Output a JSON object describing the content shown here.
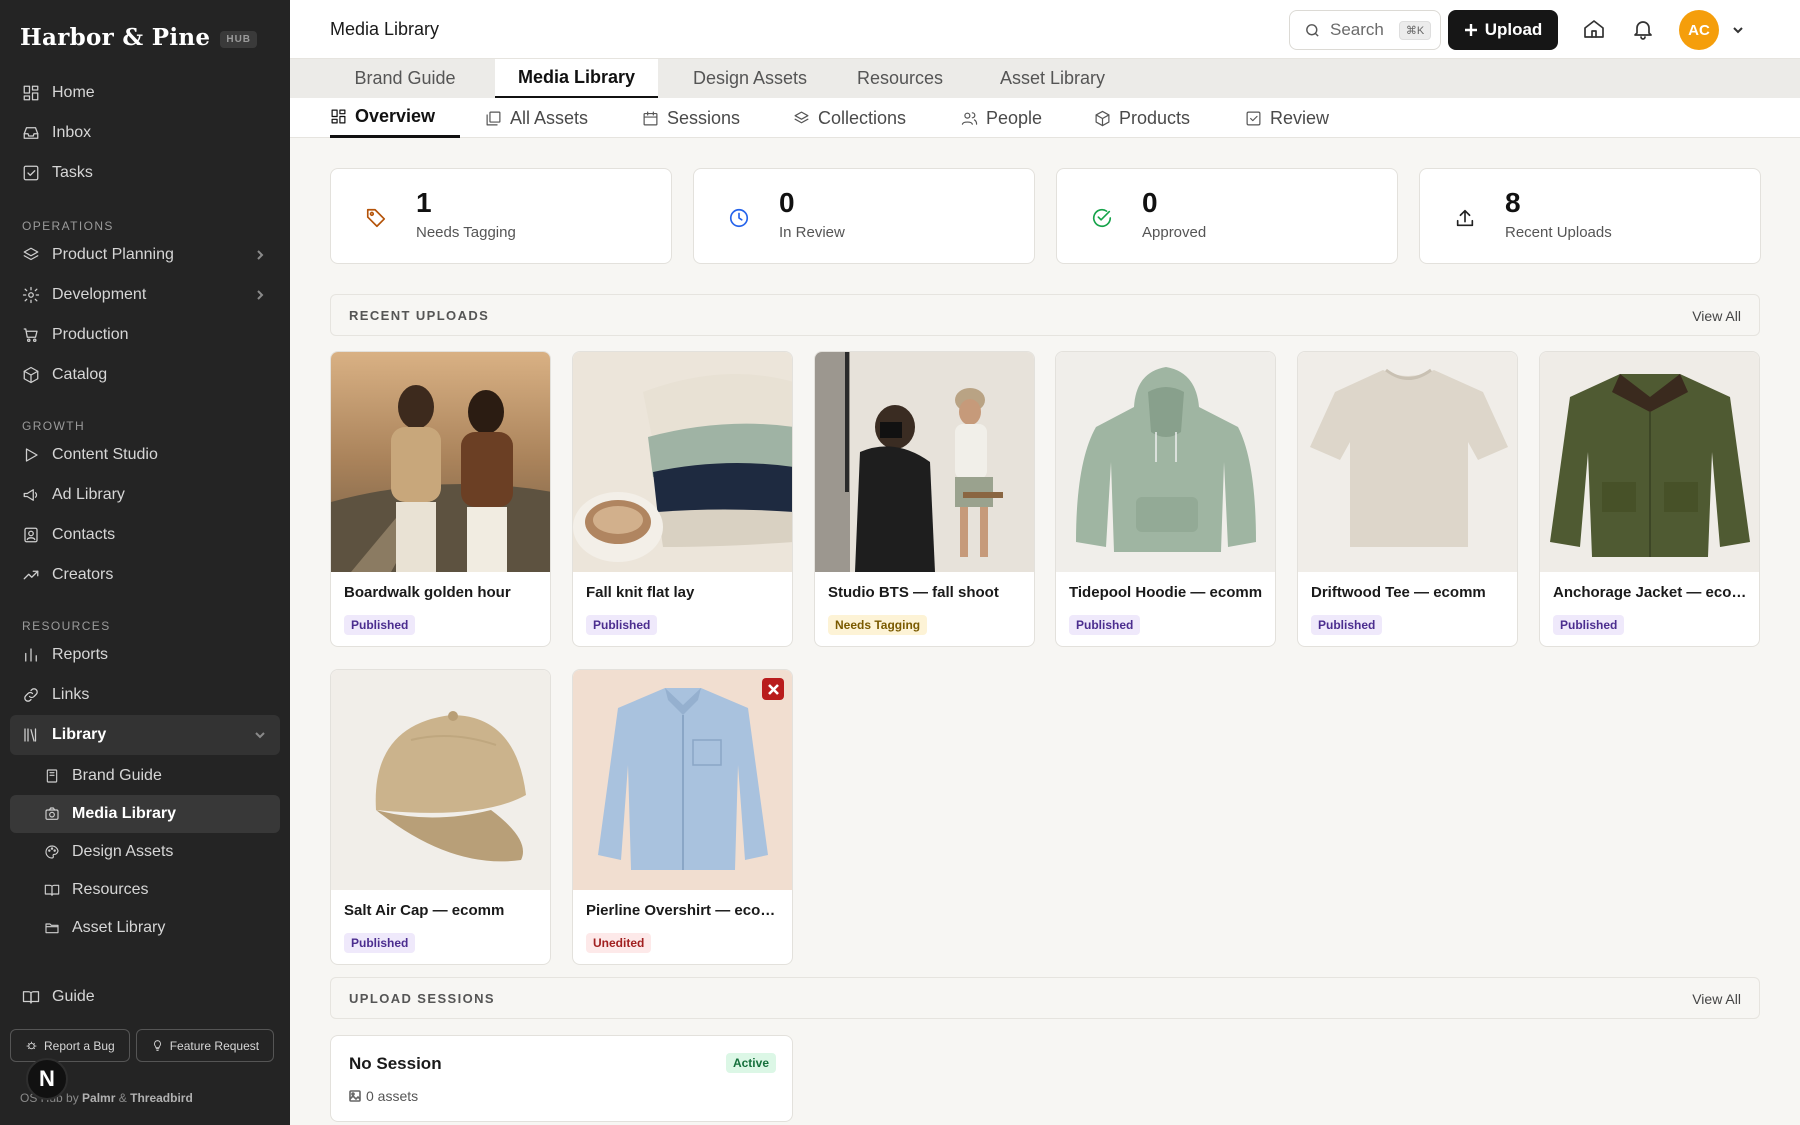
{
  "brand": {
    "name": "Harbor & Pine",
    "badge": "HUB"
  },
  "sidebar": {
    "top_items": [
      {
        "label": "Home",
        "icon": "dashboard-icon"
      },
      {
        "label": "Inbox",
        "icon": "inbox-icon"
      },
      {
        "label": "Tasks",
        "icon": "checkbox-icon"
      }
    ],
    "sections": {
      "operations": "OPERATIONS",
      "growth": "GROWTH",
      "resources": "RESOURCES"
    },
    "operations_items": [
      {
        "label": "Product Planning",
        "icon": "layers-icon"
      },
      {
        "label": "Development",
        "icon": "gear-icon"
      },
      {
        "label": "Production",
        "icon": "cart-icon"
      },
      {
        "label": "Catalog",
        "icon": "box-icon"
      }
    ],
    "growth_items": [
      {
        "label": "Content Studio",
        "icon": "play-icon"
      },
      {
        "label": "Ad Library",
        "icon": "megaphone-icon"
      },
      {
        "label": "Contacts",
        "icon": "contact-icon"
      },
      {
        "label": "Creators",
        "icon": "trend-icon"
      }
    ],
    "resources_items": [
      {
        "label": "Reports",
        "icon": "bar-chart-icon"
      },
      {
        "label": "Links",
        "icon": "link-icon"
      },
      {
        "label": "Library",
        "icon": "library-icon"
      }
    ],
    "library_sub": [
      {
        "label": "Brand Guide",
        "icon": "book-icon"
      },
      {
        "label": "Media Library",
        "icon": "camera-icon"
      },
      {
        "label": "Design Assets",
        "icon": "palette-icon"
      },
      {
        "label": "Resources",
        "icon": "open-book-icon"
      },
      {
        "label": "Asset Library",
        "icon": "folder-icon"
      }
    ],
    "guide": "Guide",
    "report_bug": "Report a Bug",
    "feature_request": "Feature Request",
    "powered_prefix": "OS Hub by",
    "powered_a": "Palmr",
    "powered_amp": "&",
    "powered_b": "Threadbird",
    "n_badge": "N"
  },
  "topbar": {
    "title": "Media Library",
    "search_label": "Search",
    "search_kbd": "⌘K",
    "upload_label": "Upload",
    "avatar_initials": "AC"
  },
  "library_tabs": [
    "Brand Guide",
    "Media Library",
    "Design Assets",
    "Resources",
    "Asset Library"
  ],
  "sub_tabs": [
    "Overview",
    "All Assets",
    "Sessions",
    "Collections",
    "People",
    "Products",
    "Review"
  ],
  "stats": [
    {
      "value": "1",
      "label": "Needs Tagging",
      "icon": "tag-icon",
      "color": "#b45309"
    },
    {
      "value": "0",
      "label": "In Review",
      "icon": "clock-icon",
      "color": "#2563eb"
    },
    {
      "value": "0",
      "label": "Approved",
      "icon": "check-circle-icon",
      "color": "#16a34a"
    },
    {
      "value": "8",
      "label": "Recent Uploads",
      "icon": "upload-icon",
      "color": "#222222"
    }
  ],
  "recent_uploads": {
    "title": "RECENT UPLOADS",
    "view_all": "View All",
    "items": [
      {
        "name": "Boardwalk golden hour",
        "status": "Published"
      },
      {
        "name": "Fall knit flat lay",
        "status": "Published"
      },
      {
        "name": "Studio BTS — fall shoot",
        "status": "Needs Tagging"
      },
      {
        "name": "Tidepool Hoodie — ecomm",
        "status": "Published"
      },
      {
        "name": "Driftwood Tee — ecomm",
        "status": "Published"
      },
      {
        "name": "Anchorage Jacket — ecomm",
        "status": "Published"
      },
      {
        "name": "Salt Air Cap — ecomm",
        "status": "Published"
      },
      {
        "name": "Pierline Overshirt — ecomm",
        "status": "Unedited"
      }
    ]
  },
  "upload_sessions": {
    "title": "UPLOAD SESSIONS",
    "view_all": "View All",
    "session_name": "No Session",
    "session_status": "Active",
    "session_count": "0 assets"
  },
  "colors": {
    "sidebar_bg": "#242424",
    "accent_dark": "#161616",
    "avatar": "#f59e0b",
    "published": "#4b2d8f",
    "needs_tagging": "#7a5a00",
    "unedited": "#a12020"
  }
}
